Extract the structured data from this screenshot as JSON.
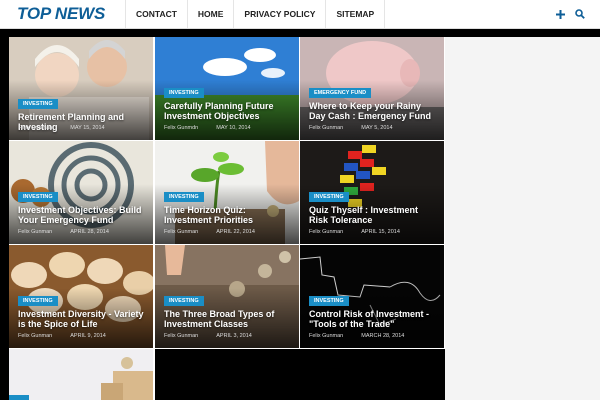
{
  "logo": "TOP NEWS",
  "nav": [
    "CONTACT",
    "HOME",
    "PRIVACY POLICY",
    "SITEMAP"
  ],
  "tools": {
    "add": "+",
    "search": "⌕"
  },
  "icons": {
    "add": "plus-icon",
    "search": "search-icon"
  },
  "colors": {
    "brand": "#0e5e97",
    "badge": "#1a8ec6",
    "background": "#000000"
  },
  "articles": [
    {
      "badge": "INVESTING",
      "title": "Retirement Planning and Investing",
      "author": "Felix Gunman",
      "date": "MAY 15, 2014"
    },
    {
      "badge": "INVESTING",
      "title": "Carefully Planning Future Investment Objectives",
      "author": "Felix Gunmdn",
      "date": "MAY 10, 2014"
    },
    {
      "badge": "EMERGENCY FUND",
      "title": "Where to Keep your Rainy Day Cash : Emergency Fund",
      "author": "Felix Gunman",
      "date": "MAY 5, 2014"
    },
    {
      "badge": "INVESTING",
      "title": "Investment Objectives: Build Your Emergency Fund",
      "author": "Felix Gunman",
      "date": "APRIL 28, 2014"
    },
    {
      "badge": "INVESTING",
      "title": "Time Horizon Quiz: Investment Priorities",
      "author": "Felix Gunman",
      "date": "APRIL 22, 2014"
    },
    {
      "badge": "INVESTING",
      "title": "Quiz Thyself : Investment Risk Tolerance",
      "author": "Felix Gunman",
      "date": "APRIL 15, 2014"
    },
    {
      "badge": "INVESTING",
      "title": "Investment Diversity - Variety is the Spice of Life",
      "author": "Felix Gunman",
      "date": "APRIL 9, 2014"
    },
    {
      "badge": "INVESTING",
      "title": "The Three Broad Types of Investment Classes",
      "author": "Felix Gunman",
      "date": "APRIL 3, 2014"
    },
    {
      "badge": "INVESTING",
      "title": "Control Risk of Investment - \"Tools of the Trade\"",
      "author": "Felix Gunman",
      "date": "MARCH 28, 2014"
    }
  ]
}
